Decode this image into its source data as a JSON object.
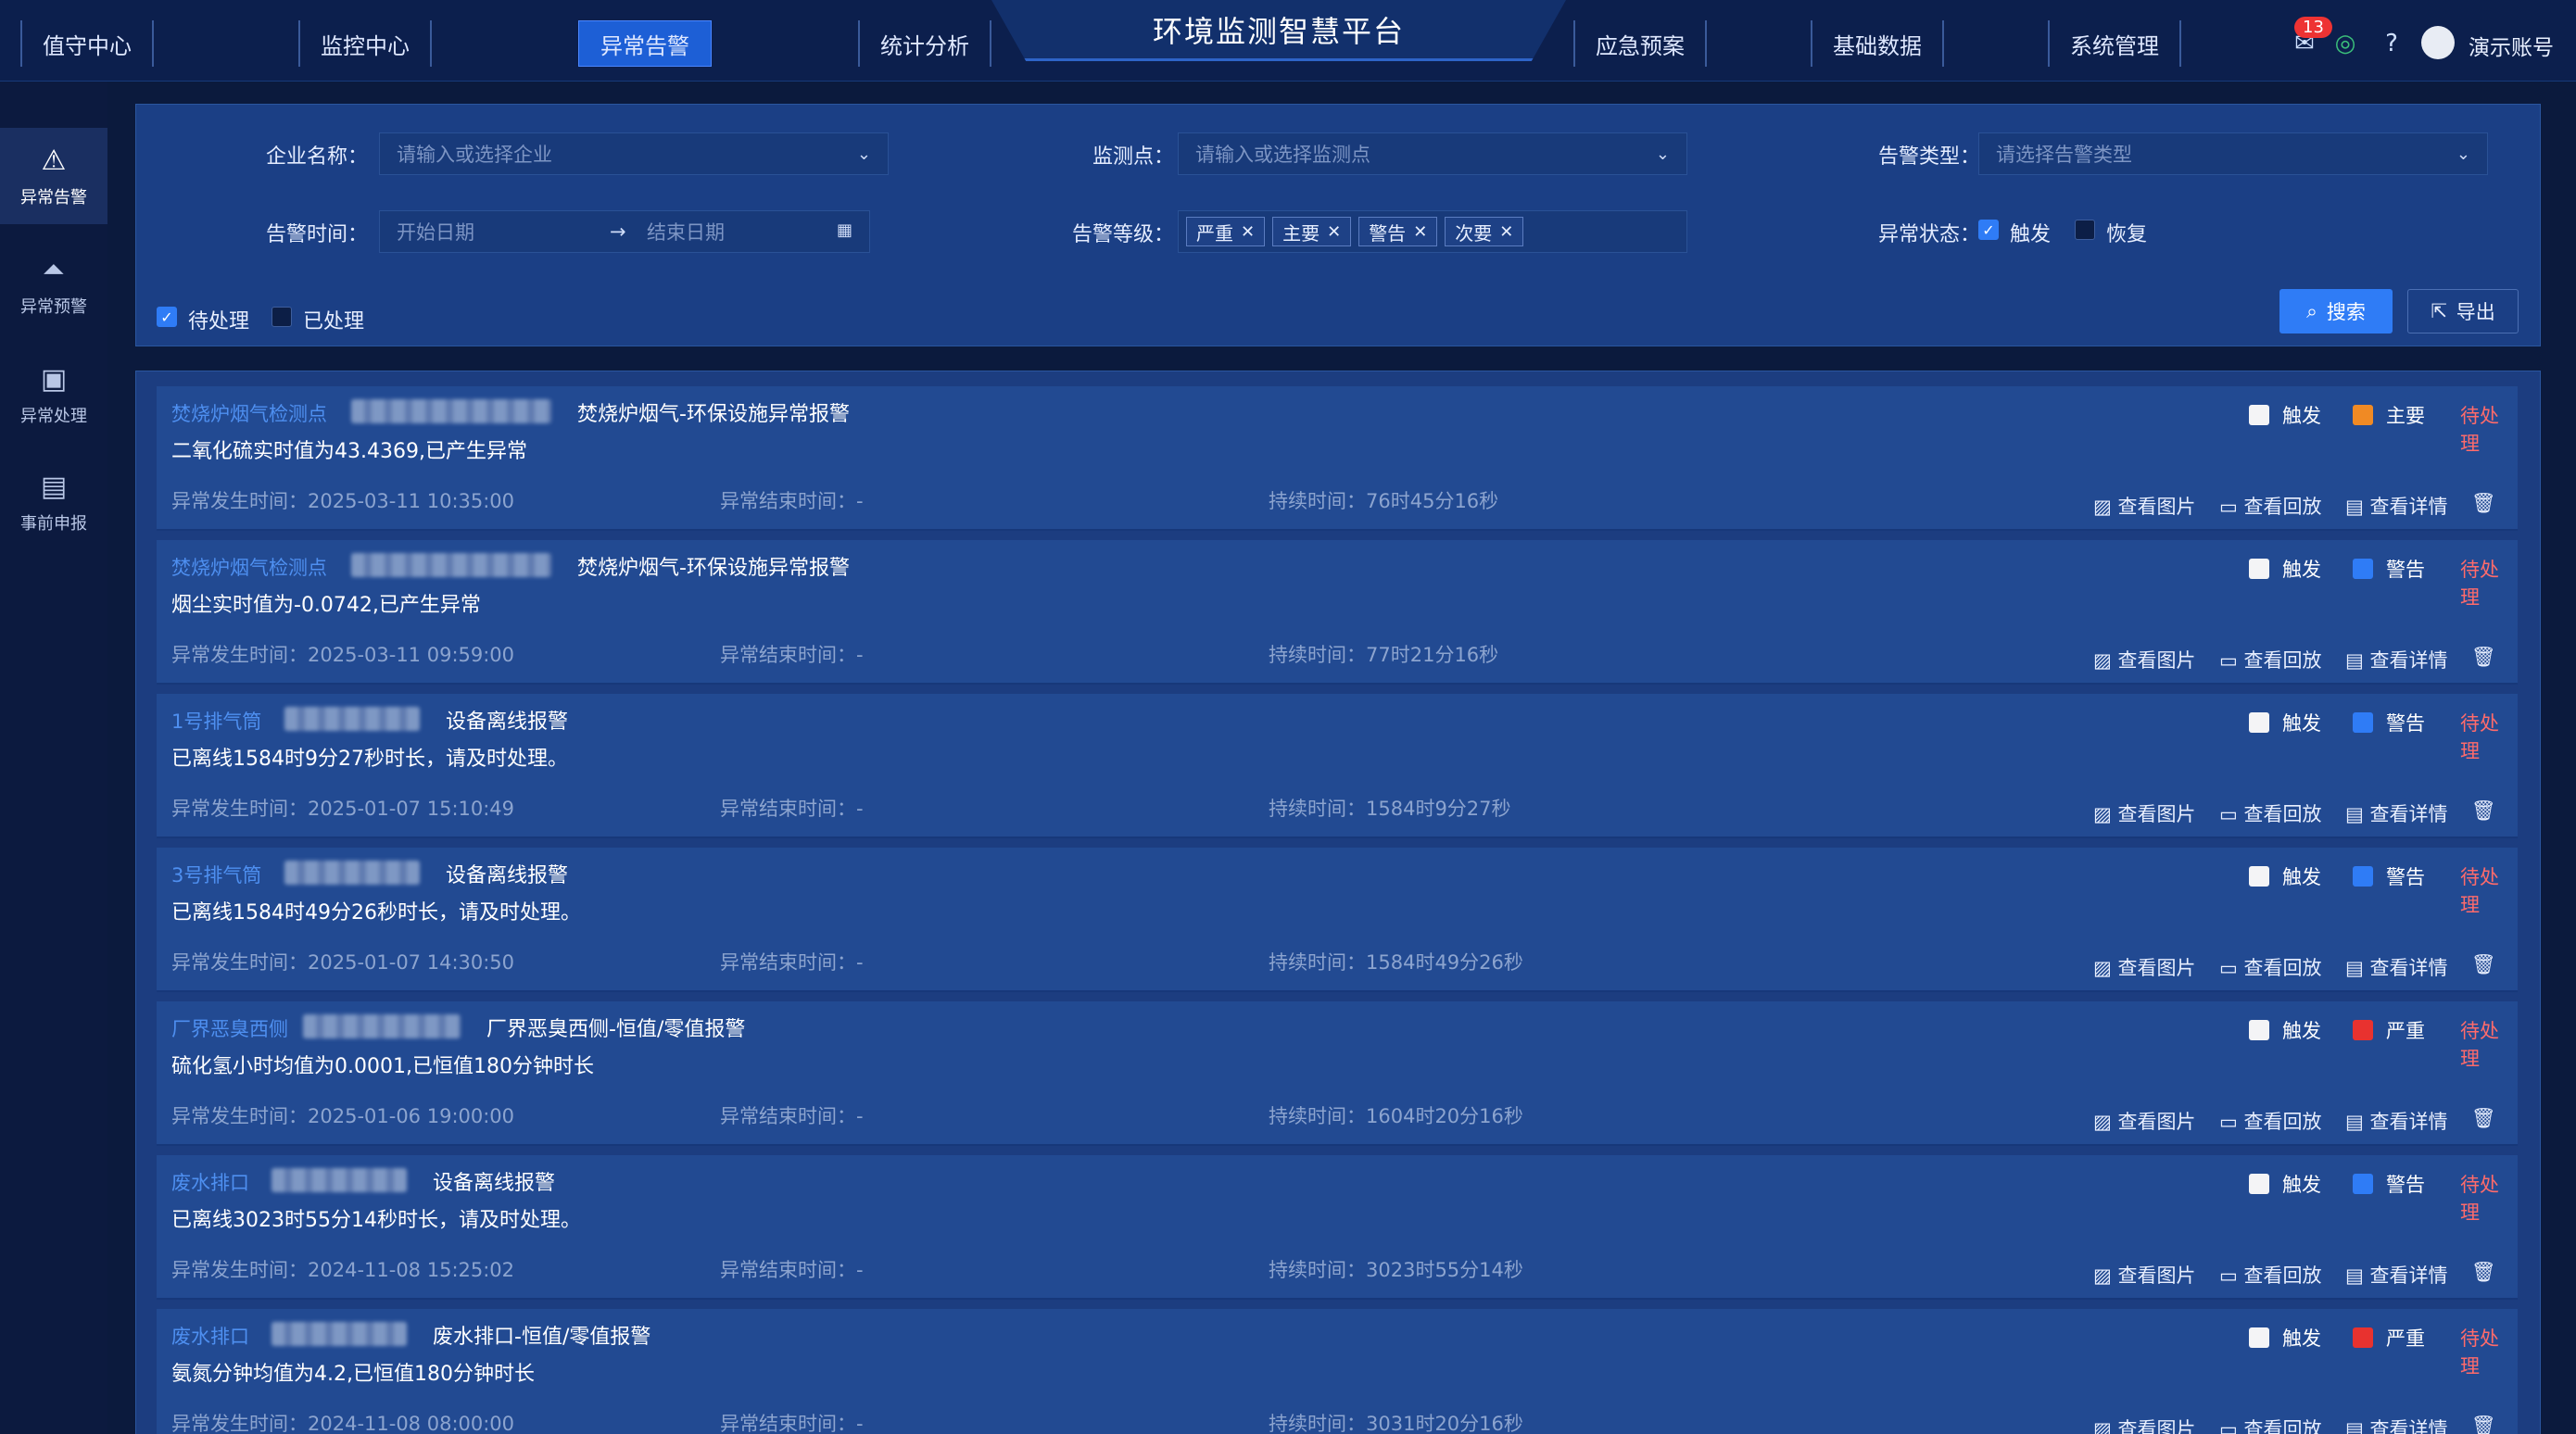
{
  "nav": {
    "left": [
      "值守中心",
      "监控中心",
      "异常告警",
      "统计分析"
    ],
    "right": [
      "应急预案",
      "基础数据",
      "系统管理"
    ],
    "title": "环境监测智慧平台",
    "badge": "13",
    "user": "演示账号"
  },
  "sidebar": [
    "异常告警",
    "异常预警",
    "异常处理",
    "事前申报"
  ],
  "filters": {
    "company_label": "企业名称：",
    "company_ph": "请输入或选择企业",
    "point_label": "监测点：",
    "point_ph": "请输入或选择监测点",
    "type_label": "告警类型：",
    "type_ph": "请选择告警类型",
    "time_label": "告警时间：",
    "start_ph": "开始日期",
    "end_ph": "结束日期",
    "level_label": "告警等级：",
    "levels": [
      "严重",
      "主要",
      "警告",
      "次要"
    ],
    "state_label": "异常状态：",
    "trigger": "触发",
    "recover": "恢复",
    "pending": "待处理",
    "processed": "已处理",
    "search": "搜索",
    "export": "导出"
  },
  "labels": {
    "start": "异常发生时间：",
    "end": "异常结束时间：",
    "duration": "持续时间：",
    "view_img": "查看图片",
    "view_play": "查看回放",
    "view_detail": "查看详情"
  },
  "alarms": [
    {
      "point": "焚烧炉烟气检测点",
      "type": "焚烧炉烟气-环保设施异常报警",
      "desc": "二氧化硫实时值为43.4369,已产生异常",
      "start": "2025-03-11 10:35:00",
      "end": "-",
      "duration": "76时45分16秒",
      "trigger": "触发",
      "level": "主要",
      "level_color": "#f08a24",
      "status": "待处理"
    },
    {
      "point": "焚烧炉烟气检测点",
      "type": "焚烧炉烟气-环保设施异常报警",
      "desc": "烟尘实时值为-0.0742,已产生异常",
      "start": "2025-03-11 09:59:00",
      "end": "-",
      "duration": "77时21分16秒",
      "trigger": "触发",
      "level": "警告",
      "level_color": "#2f7cf6",
      "status": "待处理"
    },
    {
      "point": "1号排气筒",
      "type": "设备离线报警",
      "desc": "已离线1584时9分27秒时长，请及时处理。",
      "start": "2025-01-07 15:10:49",
      "end": "-",
      "duration": "1584时9分27秒",
      "trigger": "触发",
      "level": "警告",
      "level_color": "#2f7cf6",
      "status": "待处理"
    },
    {
      "point": "3号排气筒",
      "type": "设备离线报警",
      "desc": "已离线1584时49分26秒时长，请及时处理。",
      "start": "2025-01-07 14:30:50",
      "end": "-",
      "duration": "1584时49分26秒",
      "trigger": "触发",
      "level": "警告",
      "level_color": "#2f7cf6",
      "status": "待处理"
    },
    {
      "point": "厂界恶臭西侧",
      "type": "厂界恶臭西侧-恒值/零值报警",
      "desc": "硫化氢小时均值为0.0001,已恒值180分钟时长",
      "start": "2025-01-06 19:00:00",
      "end": "-",
      "duration": "1604时20分16秒",
      "trigger": "触发",
      "level": "严重",
      "level_color": "#e8322f",
      "status": "待处理"
    },
    {
      "point": "废水排口",
      "type": "设备离线报警",
      "desc": "已离线3023时55分14秒时长，请及时处理。",
      "start": "2024-11-08 15:25:02",
      "end": "-",
      "duration": "3023时55分14秒",
      "trigger": "触发",
      "level": "警告",
      "level_color": "#2f7cf6",
      "status": "待处理"
    },
    {
      "point": "废水排口",
      "type": "废水排口-恒值/零值报警",
      "desc": "氨氮分钟均值为4.2,已恒值180分钟时长",
      "start": "2024-11-08 08:00:00",
      "end": "-",
      "duration": "3031时20分16秒",
      "trigger": "触发",
      "level": "严重",
      "level_color": "#e8322f",
      "status": "待处理"
    }
  ]
}
